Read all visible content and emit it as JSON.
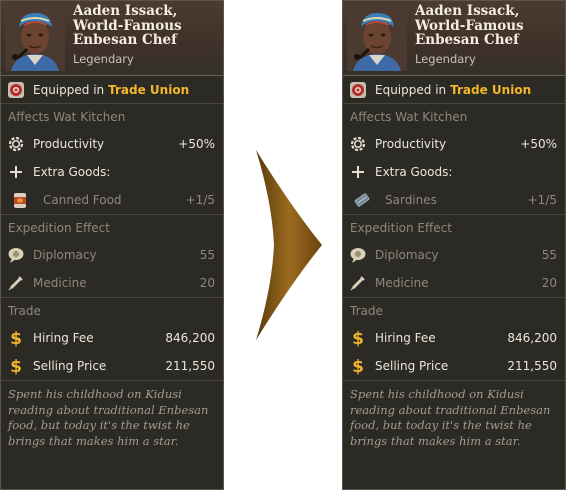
{
  "cards": [
    {
      "name_lines": [
        "Aaden Issack,",
        "World-Famous",
        "Enbesan Chef"
      ],
      "rarity": "Legendary",
      "equipped_prefix": "Equipped in",
      "equipped_in": "Trade Union",
      "affects": "Affects Wat Kitchen",
      "productivity_label": "Productivity",
      "productivity_value": "+50%",
      "extra_goods_label": "Extra Goods:",
      "good_label": "Canned Food",
      "good_value": "+1/5",
      "good_icon": "canned-food-icon",
      "expedition_title": "Expedition Effect",
      "diplomacy_label": "Diplomacy",
      "diplomacy_value": "55",
      "medicine_label": "Medicine",
      "medicine_value": "20",
      "trade_title": "Trade",
      "hiring_fee_label": "Hiring Fee",
      "hiring_fee_value": "846,200",
      "selling_price_label": "Selling Price",
      "selling_price_value": "211,550",
      "flavor": "Spent his childhood on Kidusi reading about traditional Enbesan food, but today it's the twist he brings that makes him a star."
    },
    {
      "name_lines": [
        "Aaden Issack,",
        "World-Famous",
        "Enbesan Chef"
      ],
      "rarity": "Legendary",
      "equipped_prefix": "Equipped in",
      "equipped_in": "Trade Union",
      "affects": "Affects Wat Kitchen",
      "productivity_label": "Productivity",
      "productivity_value": "+50%",
      "extra_goods_label": "Extra Goods:",
      "good_label": "Sardines",
      "good_value": "+1/5",
      "good_icon": "sardines-icon",
      "expedition_title": "Expedition Effect",
      "diplomacy_label": "Diplomacy",
      "diplomacy_value": "55",
      "medicine_label": "Medicine",
      "medicine_value": "20",
      "trade_title": "Trade",
      "hiring_fee_label": "Hiring Fee",
      "hiring_fee_value": "846,200",
      "selling_price_label": "Selling Price",
      "selling_price_value": "211,550",
      "flavor": "Spent his childhood on Kidusi reading about traditional Enbesan food, but today it's the twist he brings that makes him a star."
    }
  ],
  "colors": {
    "card_bg": "#2b2a25",
    "header_bg": "#4c3b30",
    "highlight": "#f3b72a",
    "dim_text": "#8e887b",
    "arrow": "#8a5a14"
  },
  "icons": [
    "portrait",
    "trade-union-icon",
    "gear-icon",
    "plus-icon",
    "speech-icon",
    "syringe-icon",
    "dollar-icon",
    "arrow-icon"
  ]
}
